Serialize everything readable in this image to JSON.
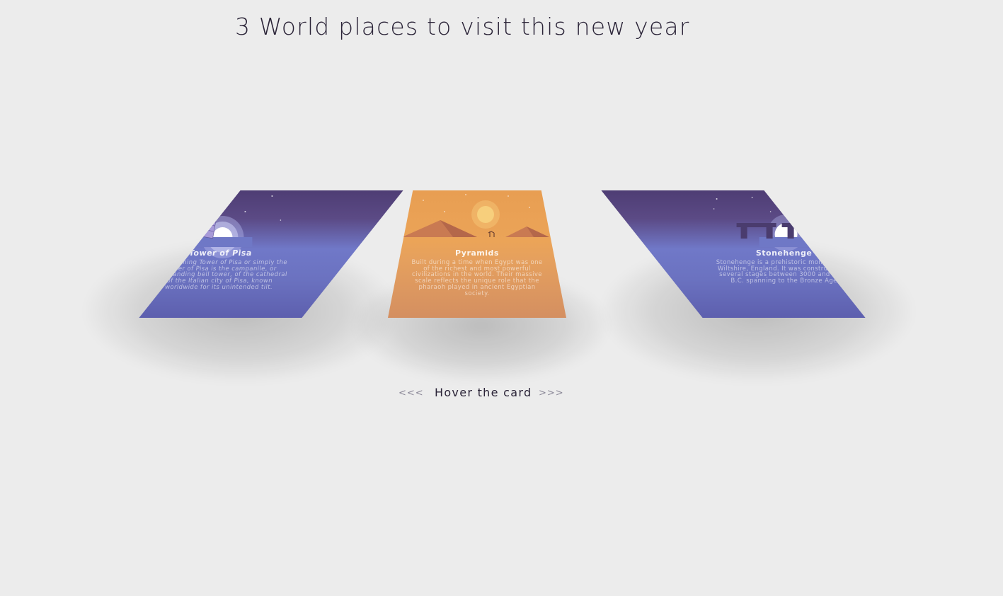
{
  "page": {
    "title": "3 World places to visit this new year"
  },
  "cards": [
    {
      "title": "Tower of Pisa",
      "description": "The Leaning Tower of Pisa or simply the Tower of Pisa is the campanile, or freestanding bell tower, of the cathedral of the Italian city of Pisa, known worldwide for its unintended tilt.",
      "theme": "#6b72c0"
    },
    {
      "title": "Pyramids",
      "description": "Built during a time when Egypt was one of the richest and most powerful civilizations in the world. Their massive scale reflects the unique role that the pharaoh played in ancient Egyptian society.",
      "theme": "#e5a05e"
    },
    {
      "title": "Stonehenge",
      "description": "Stonehenge is a prehistoric monument in Wiltshire, England. It was constructed in several stages between 3000 and 1500 B.C. spanning to the Bronze Age",
      "theme": "#6b72c0"
    }
  ],
  "hint": {
    "prev_arrow": "<<<",
    "label": "Hover the card",
    "next_arrow": ">>>"
  },
  "icons": [
    "tower-icon",
    "moon-icon",
    "sun-icon",
    "pyramid-icon",
    "camel-icon",
    "stonehenge-icon",
    "star-icon"
  ]
}
